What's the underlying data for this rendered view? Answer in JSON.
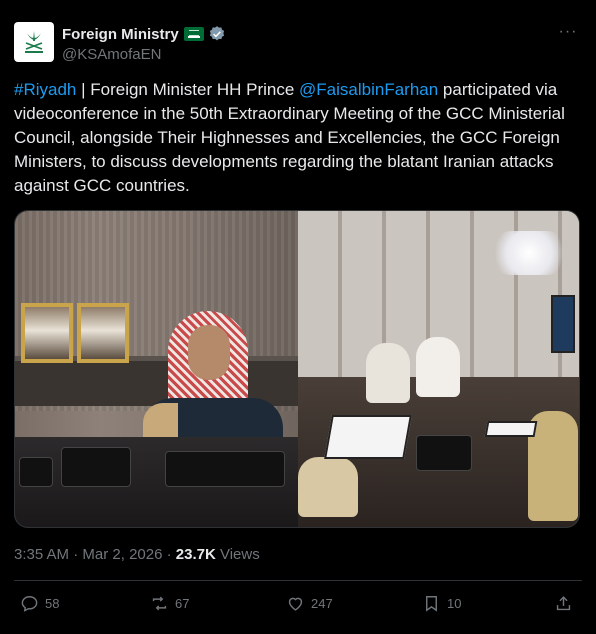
{
  "account": {
    "display_name": "Foreign Ministry",
    "handle": "@KSAmofaEN",
    "verified": true,
    "flag_icon": "saudi-flag-icon",
    "avatar_icon": "saudi-emblem-icon"
  },
  "tweet": {
    "segments": [
      {
        "text": "#Riyadh",
        "link": true
      },
      {
        "text": " | Foreign Minister HH Prince ",
        "link": false
      },
      {
        "text": "@FaisalbinFarhan",
        "link": true
      },
      {
        "text": " participated via videoconference in the 50th Extraordinary Meeting of the GCC Ministerial Council, alongside Their Highnesses and Excellencies, the GCC Foreign Ministers, to discuss developments regarding the blatant Iranian attacks against GCC countries.",
        "link": false
      }
    ]
  },
  "meta": {
    "time": "3:35 AM",
    "separator": " · ",
    "date": "Mar 2, 2026",
    "views_count": "23.7K",
    "views_label": " Views"
  },
  "actions": {
    "replies": "58",
    "reposts": "67",
    "likes": "247",
    "bookmarks": "10"
  },
  "colors": {
    "background": "#000000",
    "text": "#e7e9ea",
    "muted": "#71767b",
    "link": "#1d9bf0",
    "divider": "#2f3336",
    "verified": "#829aab"
  }
}
